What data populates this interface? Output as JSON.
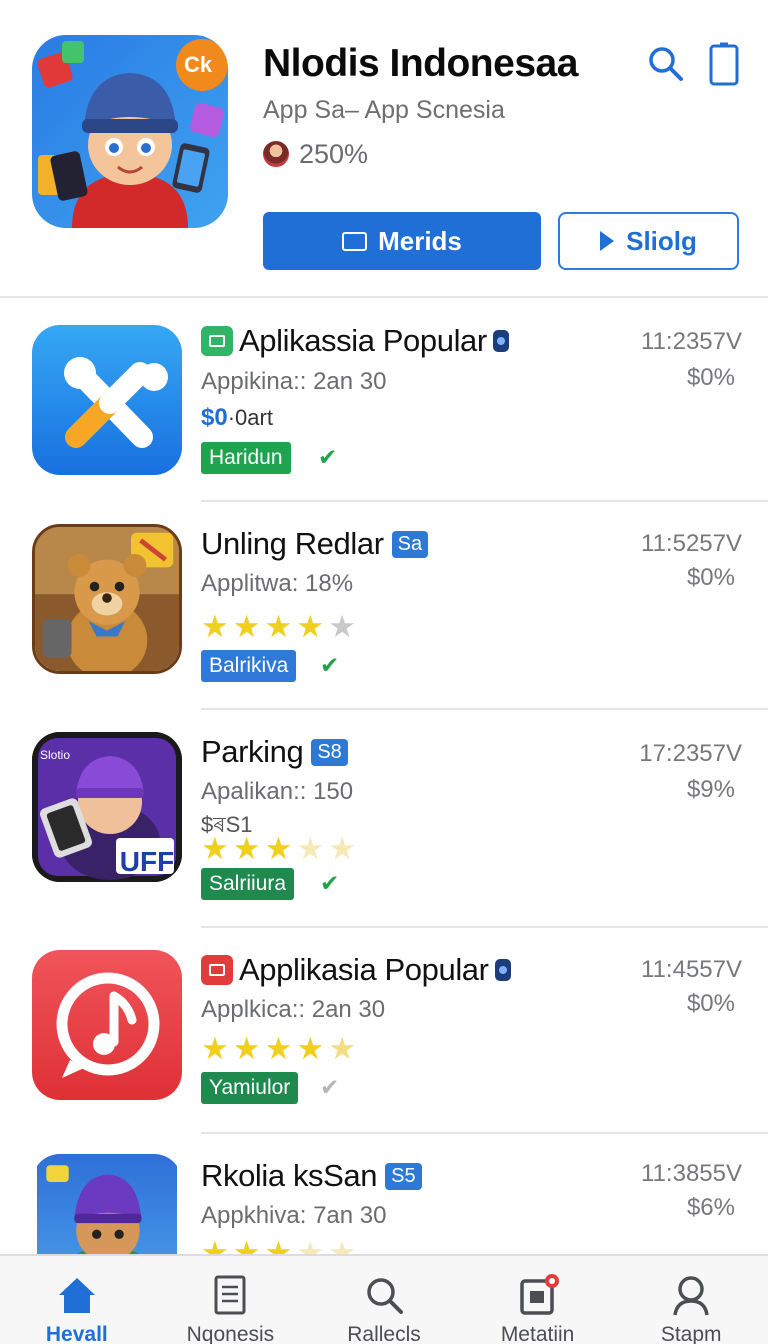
{
  "header": {
    "app_title": "Nlodis Indonesaa",
    "subtitle": "App Sa– App Scnesia",
    "rating": "250%",
    "primary_button": "Merids",
    "secondary_button": "Sliolg",
    "hero_badge": "Ck"
  },
  "colors": {
    "accent": "#1f6fd6",
    "divider": "#e3e5e8",
    "star": "#f0cf1e"
  },
  "list": [
    {
      "title": "Aplikassia Popular",
      "subtitle": "Appikina:: 2an 30",
      "price_prefix": "$0",
      "price_suffix": "·0art",
      "status": "Haridun",
      "time": "11:2357V",
      "percent": "$0%"
    },
    {
      "title": "Unling Redlar",
      "badge": "Sa",
      "subtitle": "Applitwa: 18%",
      "rating": 4,
      "status": "Balrikiva",
      "time": "11:5257V",
      "percent": "$0%"
    },
    {
      "title": "Parking",
      "badge": "S8",
      "subtitle": "Apalikan:: 150",
      "extra": "$ৰS1",
      "rating": 3,
      "status": "Salriiura",
      "time": "17:2357V",
      "percent": "$9%",
      "icon_label": "UFF",
      "icon_caption": "Slotio"
    },
    {
      "title": "Applikasia Popular",
      "subtitle": "Applkica:: 2an 30",
      "rating": 4,
      "status": "Yamiulor",
      "time": "11:4557V",
      "percent": "$0%"
    },
    {
      "title": "Rkolia ksSan",
      "badge": "S5",
      "subtitle": "Appkhiva: 7an 30",
      "rating": 3,
      "time": "11:3855V",
      "percent": "$6%"
    }
  ],
  "nav": [
    {
      "label": "Hevall",
      "icon": "home-icon",
      "active": true
    },
    {
      "label": "Nqonesis",
      "icon": "document-icon"
    },
    {
      "label": "Rallecls",
      "icon": "search-icon"
    },
    {
      "label": "Metatiin",
      "icon": "notification-icon"
    },
    {
      "label": "Stapm",
      "icon": "profile-icon"
    }
  ]
}
